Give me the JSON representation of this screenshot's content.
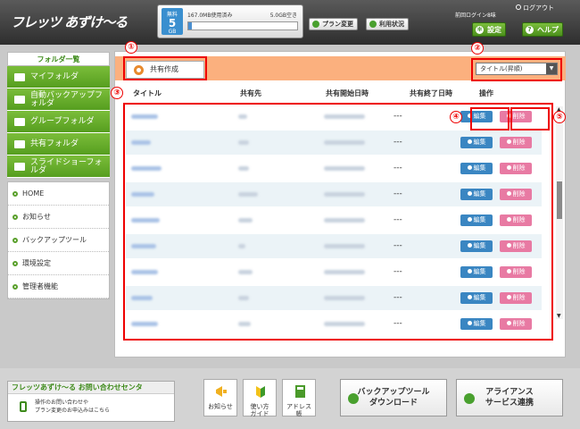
{
  "header": {
    "logo": "フレッツ あずけ～る",
    "quota": {
      "small": "無料",
      "big": "5",
      "unit": "GB",
      "used_text": "167.0MB使用済み",
      "free_text": "5.0GB空き",
      "used_fraction": 0.03
    },
    "plan_change": "プラン変更",
    "usage_status": "利用状況",
    "last_login": "前回ログイン8味",
    "logout": "ログアウト",
    "settings": "設定",
    "help": "ヘルプ"
  },
  "sidebar": {
    "folder_title": "フォルダ一覧",
    "folders": [
      "マイフォルダ",
      "自動バックアップフォルダ",
      "グループフォルダ",
      "共有フォルダ",
      "スライドショーフォルダ"
    ],
    "nav": [
      "HOME",
      "お知らせ",
      "バックアップツール",
      "環境設定",
      "管理者機能"
    ]
  },
  "main": {
    "share_button": "共有作成",
    "select_value": "タイトル(昇順)",
    "headers": {
      "title": "タイトル",
      "share_with": "共有先",
      "start": "共有開始日時",
      "end": "共有終了日時",
      "action": "操作"
    },
    "rows": [
      {
        "end": "---",
        "edit": "編集",
        "delete": "削除"
      },
      {
        "end": "---",
        "edit": "編集",
        "delete": "削除"
      },
      {
        "end": "---",
        "edit": "編集",
        "delete": "削除"
      },
      {
        "end": "---",
        "edit": "編集",
        "delete": "削除"
      },
      {
        "end": "---",
        "edit": "編集",
        "delete": "削除"
      },
      {
        "end": "---",
        "edit": "編集",
        "delete": "削除"
      },
      {
        "end": "---",
        "edit": "編集",
        "delete": "削除"
      },
      {
        "end": "---",
        "edit": "編集",
        "delete": "削除"
      },
      {
        "end": "---",
        "edit": "編集",
        "delete": "削除"
      }
    ]
  },
  "annotations": [
    "①",
    "②",
    "③",
    "④",
    "⑤"
  ],
  "footer": {
    "contact_title": "フレッツあずけ～る お問い合わせセンタ",
    "contact_line1": "操作のお問い合わせや",
    "contact_line2": "プラン変更のお申込みはこちら",
    "notice": "お知らせ",
    "guide_line1": "使い方",
    "guide_line2": "ガイド",
    "address_line1": "アドレス",
    "address_line2": "帳",
    "backup_line1": "バックアップツール",
    "backup_line2": "ダウンロード",
    "alliance_line1": "アライアンス",
    "alliance_line2": "サービス連携"
  }
}
